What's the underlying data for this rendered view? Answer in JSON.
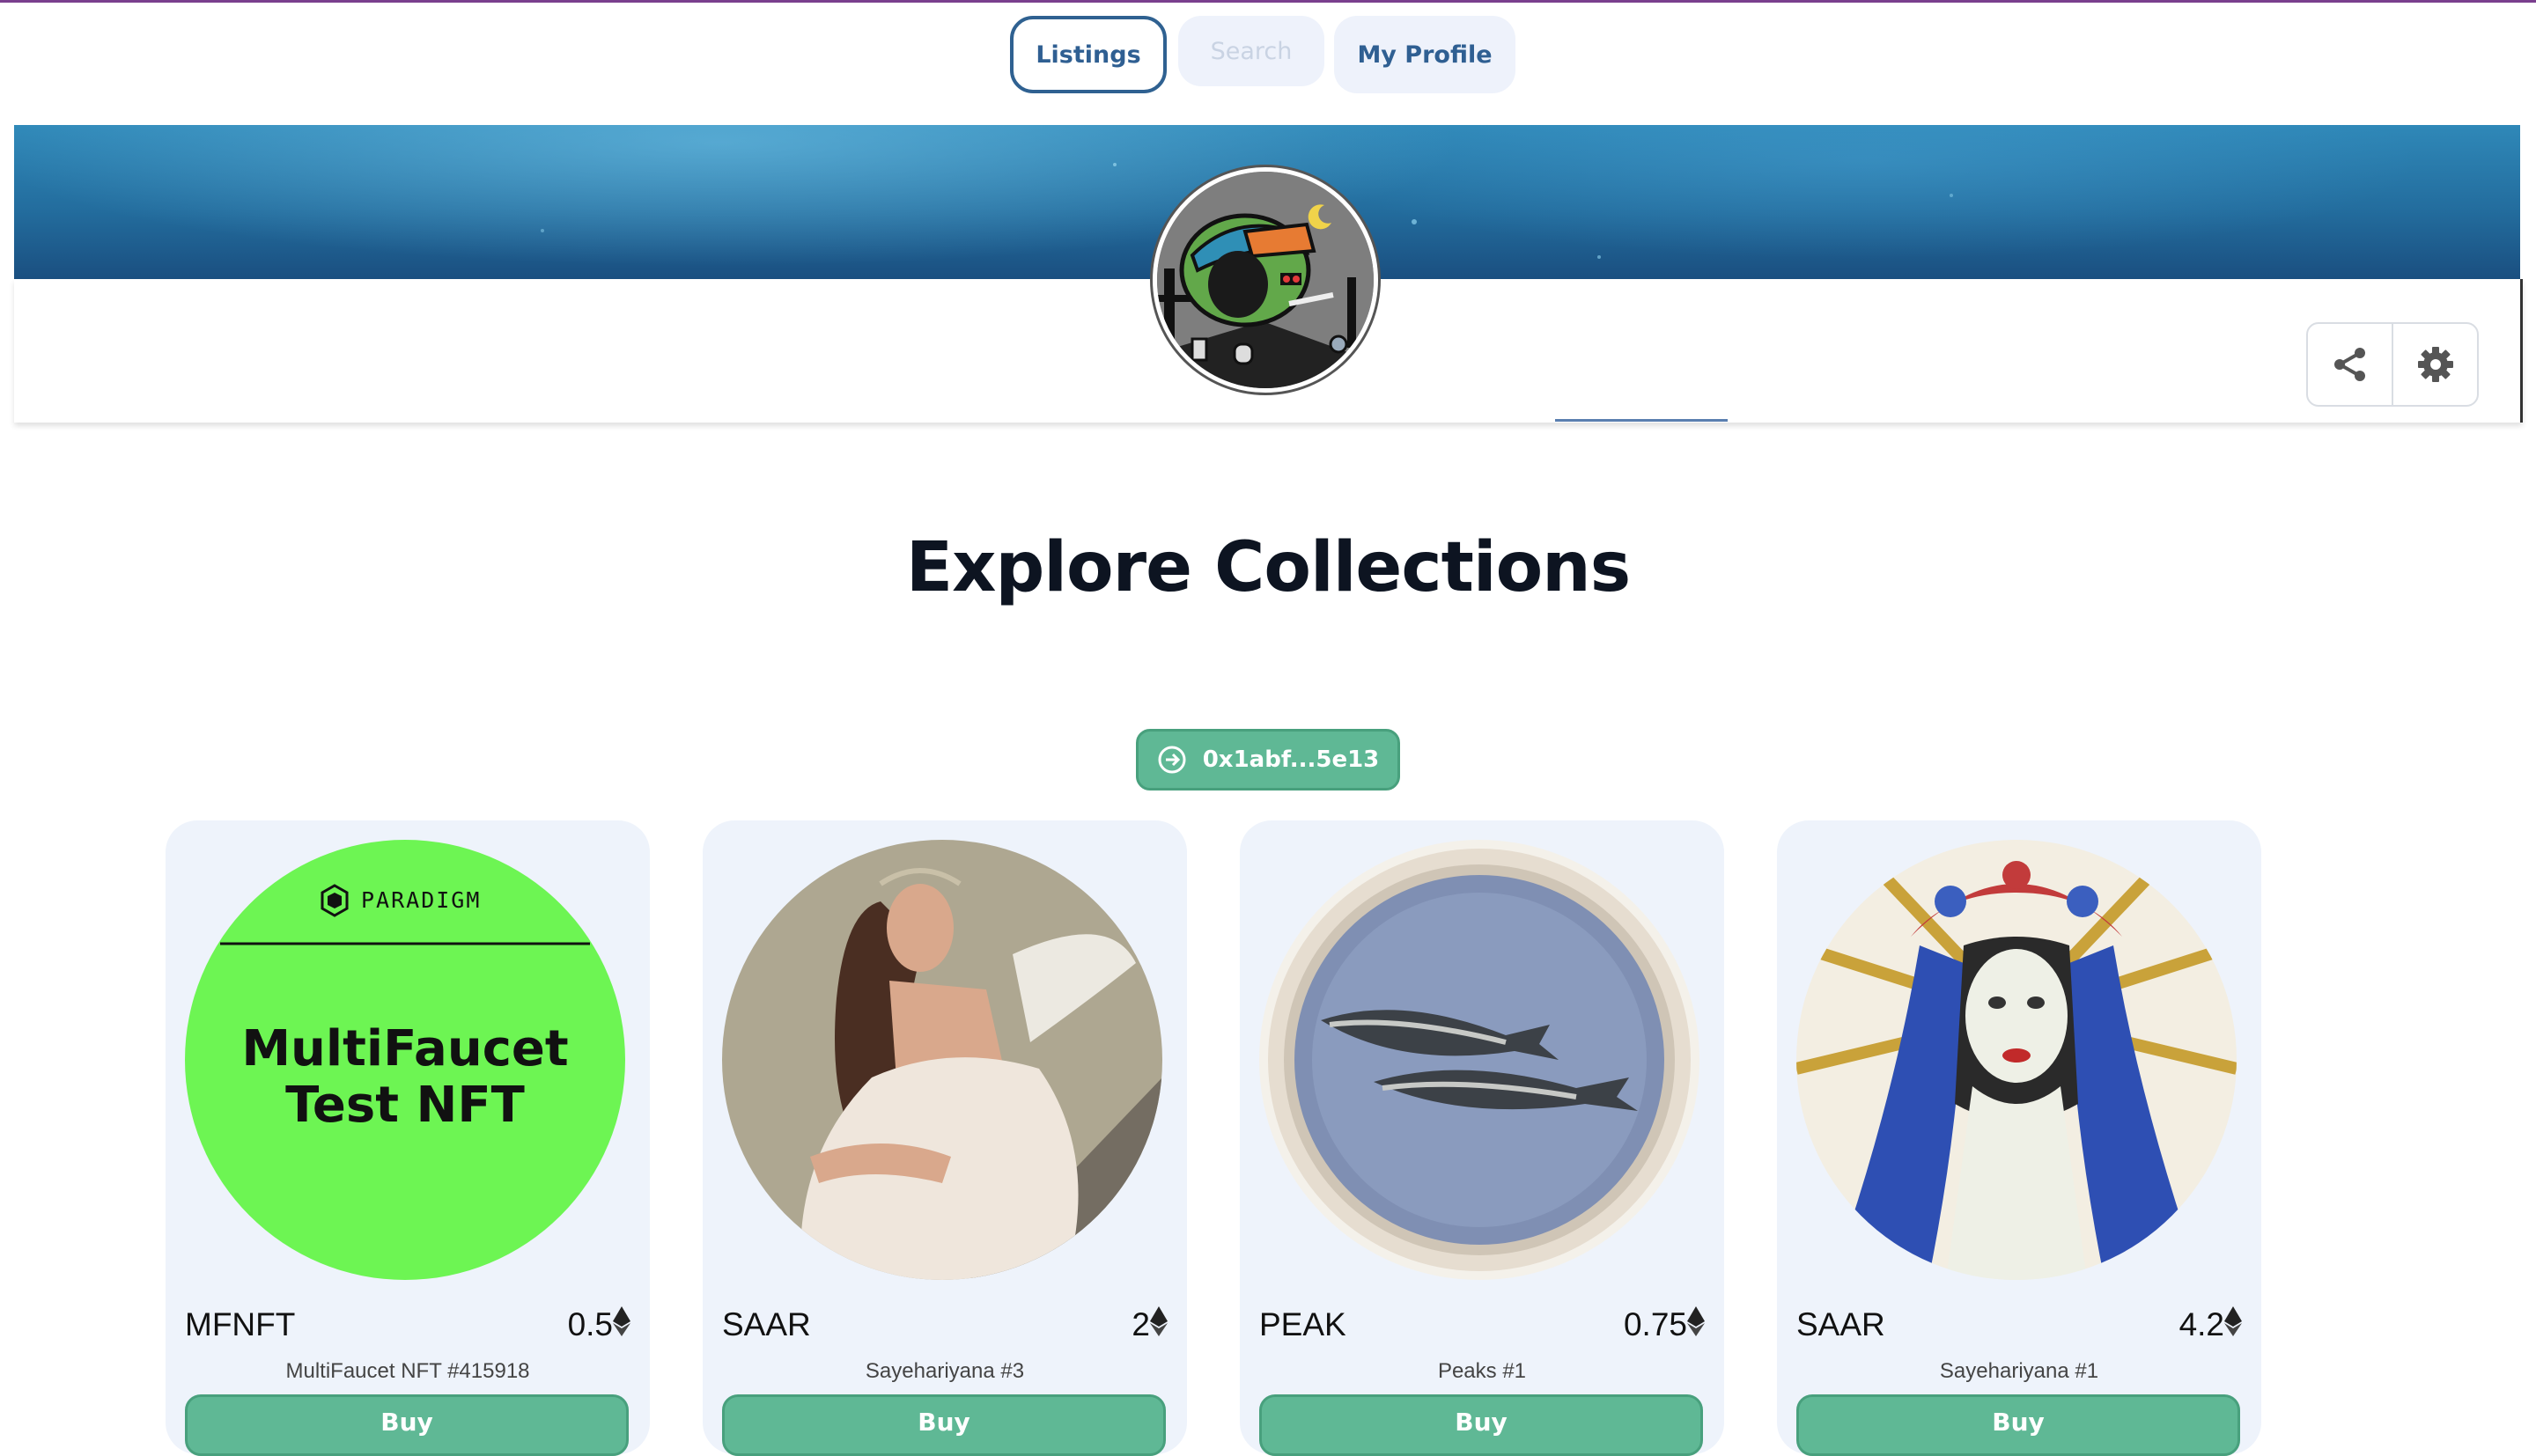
{
  "nav": {
    "listings_label": "Listings",
    "search_label": "Search",
    "profile_label": "My Profile"
  },
  "profile": {
    "actions": [
      {
        "icon": "share-icon"
      },
      {
        "icon": "gear-icon"
      }
    ]
  },
  "explore": {
    "title": "Explore Collections",
    "address": "0x1abf...5e13",
    "address_icon": "arrow-circle-icon"
  },
  "colors": {
    "accent_green": "#5fb895",
    "nav_text": "#2f5f92",
    "card_bg": "#eef3fb",
    "nft_green": "#6df553"
  },
  "cards": [
    {
      "symbol": "MFNFT",
      "price": "0.5",
      "name": "MultiFaucet NFT #415918",
      "buy_label": "Buy",
      "image": {
        "brand": "PARADIGM",
        "line1": "MultiFaucet",
        "line2": "Test NFT"
      }
    },
    {
      "symbol": "SAAR",
      "price": "2",
      "name": "Sayehariyana #3",
      "buy_label": "Buy"
    },
    {
      "symbol": "PEAK",
      "price": "0.75",
      "name": "Peaks #1",
      "buy_label": "Buy"
    },
    {
      "symbol": "SAAR",
      "price": "4.2",
      "name": "Sayehariyana #1",
      "buy_label": "Buy"
    }
  ]
}
